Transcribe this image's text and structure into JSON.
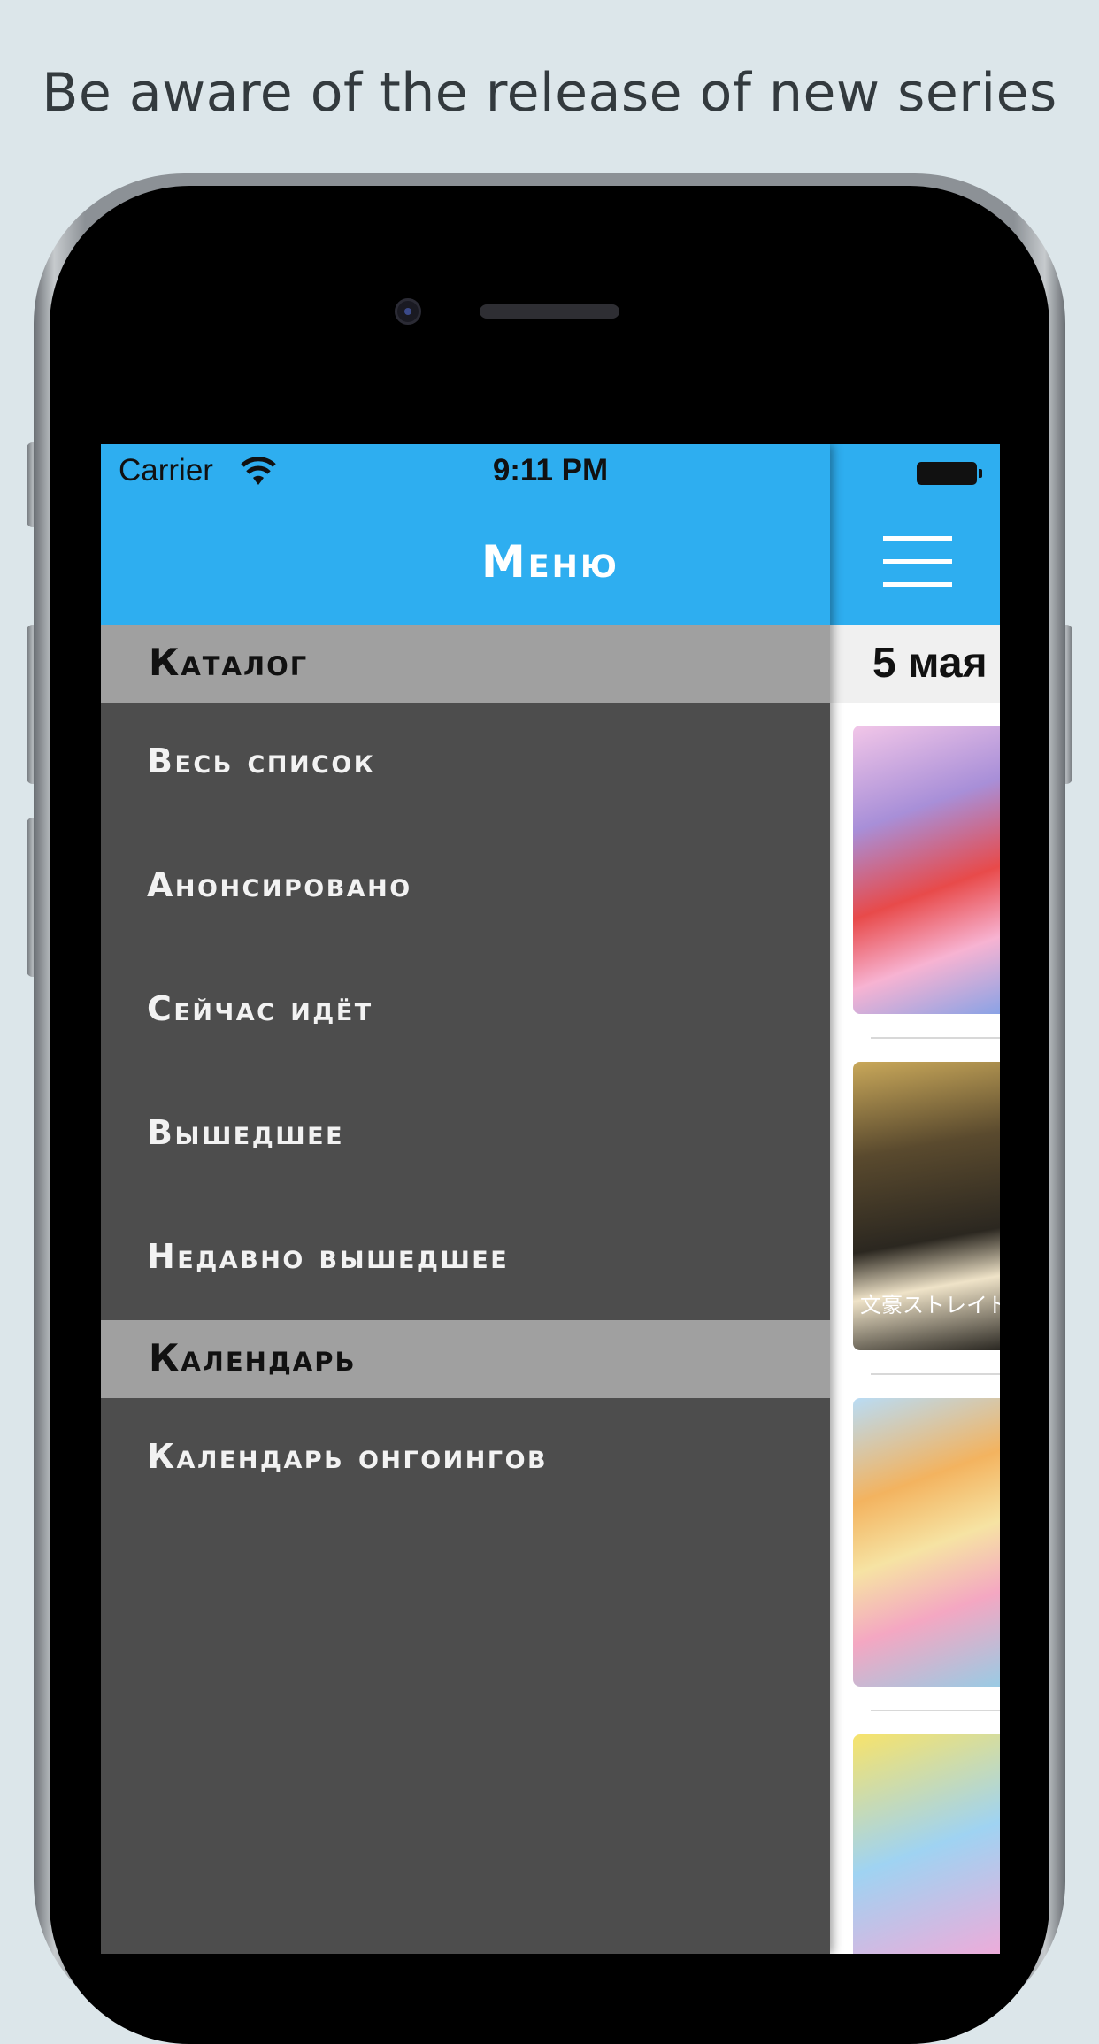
{
  "headline": "Be aware of the release of new series",
  "status_bar": {
    "carrier": "Carrier",
    "time": "9:11 PM"
  },
  "nav": {
    "title": "Меню"
  },
  "menu": {
    "sections": [
      {
        "header": "Каталог",
        "items": [
          "Весь список",
          "Анонсировано",
          "Сейчас идёт",
          "Вышедшее",
          "Недавно вышедшее"
        ]
      },
      {
        "header": "Календарь",
        "items": [
          "Календарь онгоингов"
        ]
      }
    ]
  },
  "main": {
    "date_header": "5 мая",
    "poster2_caption": "文豪ストレイド"
  },
  "colors": {
    "accent": "#2eaef0",
    "drawer_bg": "#4d4d4d",
    "section_bg": "#a0a0a0"
  }
}
